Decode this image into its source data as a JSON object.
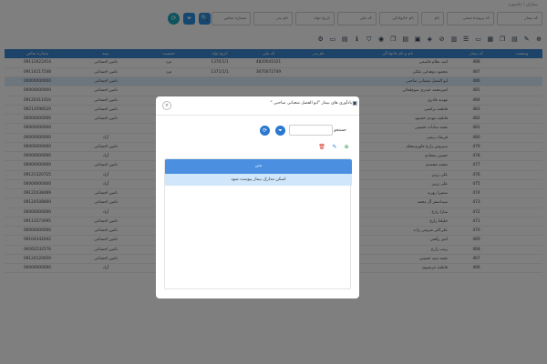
{
  "breadcrumb": "بیماران / داشبورد",
  "filters": {
    "fields": [
      "کد بیمار",
      "کد پرونده سنتی",
      "نام",
      "نام خانوادگی",
      "کد ملی",
      "تاریخ تولد",
      "نام پدر",
      "شماره تماس"
    ],
    "buttons": [
      {
        "icon": "search-icon",
        "glyph": "🔍"
      },
      {
        "icon": "filter-icon",
        "glyph": "⏷"
      },
      {
        "icon": "refresh-icon",
        "glyph": "⟳"
      }
    ]
  },
  "toolbar": {
    "icons": [
      {
        "name": "add-icon",
        "glyph": "⊕"
      },
      {
        "name": "edit-icon",
        "glyph": "✎"
      },
      {
        "name": "file-icon",
        "glyph": "▤"
      },
      {
        "name": "copy-icon",
        "glyph": "❐"
      },
      {
        "name": "calendar-icon",
        "glyph": "▦"
      },
      {
        "name": "money-icon",
        "glyph": "▭"
      },
      {
        "name": "report-icon",
        "glyph": "☰"
      },
      {
        "name": "chart-icon",
        "glyph": "▥"
      },
      {
        "name": "ban-icon",
        "glyph": "⊘"
      },
      {
        "name": "tag-icon",
        "glyph": "◈"
      },
      {
        "name": "message-icon",
        "glyph": "▣"
      },
      {
        "name": "document-icon",
        "glyph": "▤"
      },
      {
        "name": "copy-icon",
        "glyph": "❐"
      },
      {
        "name": "pin-icon",
        "glyph": "◉"
      },
      {
        "name": "shield-icon",
        "glyph": "⛉"
      },
      {
        "name": "info-icon",
        "glyph": "ℹ"
      },
      {
        "name": "print-icon",
        "glyph": "▤"
      },
      {
        "name": "monitor-icon",
        "glyph": "▭"
      },
      {
        "name": "user-settings-icon",
        "glyph": "⚙"
      }
    ]
  },
  "table": {
    "headers": [
      "وضعیت",
      "کد بیمار",
      "نام و نام خانوادگی",
      "نام پدر",
      "کد ملی",
      "تاریخ تولد",
      "جنسیت",
      "بیمه",
      "شماره تماس"
    ],
    "rows": [
      {
        "code": "488",
        "name": "امید نظام قاسمی",
        "nid": "4820041021",
        "birth": "1370/1/1",
        "gender": "مرد",
        "ins": "تامین اجتماعی",
        "phone": "09112022454"
      },
      {
        "code": "487",
        "name": "محمود دوهدانی ملکی",
        "nid": "3070072749",
        "birth": "1371/1/1",
        "gender": "مرد",
        "ins": "تامین اجتماعی",
        "phone": "09114217548"
      },
      {
        "code": "486",
        "name": "ابو الفضل شعبانی صاحبی",
        "nid": "",
        "birth": "",
        "gender": "",
        "ins": "تامین اجتماعی",
        "phone": "00000000000",
        "sel": true
      },
      {
        "code": "485",
        "name": "امیرمحمد حیدری سوچلمائی",
        "nid": "",
        "birth": "",
        "gender": "",
        "ins": "تامین اجتماعی",
        "phone": "00000000000"
      },
      {
        "code": "484",
        "name": "مهدیه قادری",
        "nid": "",
        "birth": "",
        "gender": "",
        "ins": "تامین اجتماعی",
        "phone": "09120311010"
      },
      {
        "code": "483",
        "name": "فاطمه ترکمنی",
        "nid": "",
        "birth": "",
        "gender": "",
        "ins": "تامین اجتماعی",
        "phone": "09213598520"
      },
      {
        "code": "482",
        "name": "فاطمه مهدی خشنود",
        "nid": "",
        "birth": "",
        "gender": "",
        "ins": "تامین اجتماعی",
        "phone": "00000000000"
      },
      {
        "code": "481",
        "name": "نجمه سادات حسینی",
        "nid": "",
        "birth": "",
        "gender": "",
        "ins": "",
        "phone": "00000000000"
      },
      {
        "code": "480",
        "name": "فریماه ربیعی",
        "nid": "",
        "birth": "",
        "gender": "",
        "ins": "آزاد",
        "phone": "00000000000"
      },
      {
        "code": "479",
        "name": "سیروس زارع خاوری‌محله",
        "nid": "",
        "birth": "",
        "gender": "",
        "ins": "تامین اجتماعی",
        "phone": "00000000000"
      },
      {
        "code": "478",
        "name": "حسین سجادی",
        "nid": "",
        "birth": "",
        "gender": "",
        "ins": "آزاد",
        "phone": "00000000000"
      },
      {
        "code": "477",
        "name": "محمد محمدی",
        "nid": "",
        "birth": "",
        "gender": "",
        "ins": "تامین اجتماعی",
        "phone": "00000000000"
      },
      {
        "code": "476",
        "name": "علی زرین",
        "nid": "",
        "birth": "",
        "gender": "",
        "ins": "آزاد",
        "phone": "09121320725"
      },
      {
        "code": "475",
        "name": "علی زرین",
        "nid": "",
        "birth": "",
        "gender": "",
        "ins": "آزاد",
        "phone": "00000000000"
      },
      {
        "code": "474",
        "name": "سمیرا روزبه",
        "nid": "",
        "birth": "",
        "gender": "",
        "ins": "تامین اجتماعی",
        "phone": "09122438489"
      },
      {
        "code": "473",
        "name": "سیداصغر آل محمد",
        "nid": "",
        "birth": "",
        "gender": "",
        "ins": "تامین اجتماعی",
        "phone": "09124508660"
      },
      {
        "code": "472",
        "name": "سارا زارع",
        "nid": "",
        "birth": "",
        "gender": "",
        "ins": "آزاد",
        "phone": "00000000000"
      },
      {
        "code": "471",
        "name": "خلیلعا زارع",
        "nid": "",
        "birth": "",
        "gender": "",
        "ins": "تامین اجتماعی",
        "phone": "09111573095"
      },
      {
        "code": "470",
        "name": "علی‌اکبر شریفی زاده",
        "nid": "0375864041",
        "birth": "1362/1/1",
        "gender": "مرد",
        "ins": "تامین اجتماعی",
        "phone": "00000000000"
      },
      {
        "code": "469",
        "name": "امیر رافعی",
        "nid": "0000050015",
        "birth": "",
        "gender": "مرد",
        "ins": "تامین اجتماعی",
        "phone": "09104342042"
      },
      {
        "code": "468",
        "name": "زینب زارع",
        "nid": "2060410854",
        "birth": "1363/7/7",
        "gender": "زن",
        "ins": "تامین اجتماعی",
        "phone": "09262532576"
      },
      {
        "code": "467",
        "name": "نجمه سید حسینی",
        "nid": "0072164803",
        "birth": "1363/1/1",
        "gender": "زن",
        "ins": "تامین اجتماعی",
        "phone": "09124120659"
      },
      {
        "code": "466",
        "name": "فاطمه مرتضوی",
        "nid": "4030442131",
        "birth": "1363/1/1",
        "gender": "زن",
        "ins": "آزاد",
        "phone": "00000000000"
      }
    ]
  },
  "modal": {
    "title": "یادآوری های بیمار \"ابو الفضل شعبانی صاحبی \"",
    "close": "×",
    "search_label": "جستجو",
    "buttons": [
      {
        "name": "filter-icon",
        "glyph": "⏷"
      },
      {
        "name": "refresh-icon",
        "glyph": "⟳"
      }
    ],
    "actions": [
      {
        "name": "add-icon",
        "glyph": "⊕",
        "color": "#2e9e4f"
      },
      {
        "name": "edit-icon",
        "glyph": "✎",
        "color": "#2a78d0"
      },
      {
        "name": "delete-icon",
        "glyph": "🗑",
        "color": "#d9342b"
      }
    ],
    "grid": {
      "header": "متن",
      "rows": [
        "اسکن مدارک بیمار پیوست شود"
      ]
    }
  }
}
